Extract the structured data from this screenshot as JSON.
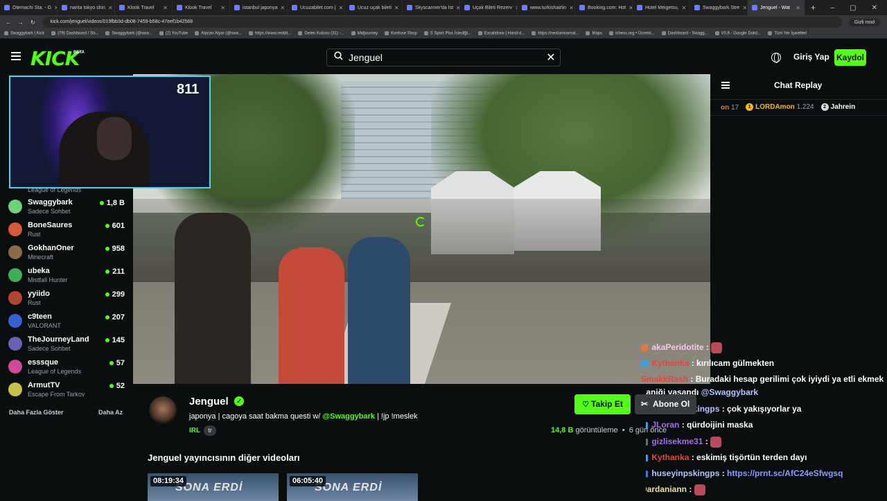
{
  "browser": {
    "tabs": [
      {
        "label": "Otemachi Sta. - G",
        "active": false
      },
      {
        "label": "narita tokyo shin",
        "active": false
      },
      {
        "label": "Klook Travel",
        "active": false
      },
      {
        "label": "Klook Travel",
        "active": false
      },
      {
        "label": "istanbul japonya",
        "active": false
      },
      {
        "label": "Ucuzabilet.com |",
        "active": false
      },
      {
        "label": "Ucuz uçak bileti",
        "active": false
      },
      {
        "label": "Skyscanner'da İst",
        "active": false
      },
      {
        "label": "Uçak Bileti Rezerv",
        "active": false
      },
      {
        "label": "www.turkishairlin",
        "active": false
      },
      {
        "label": "Booking.com: Hot",
        "active": false
      },
      {
        "label": "Hotel Meigetsu,",
        "active": false
      },
      {
        "label": "Swaggybark Stre",
        "active": false
      },
      {
        "label": "Jenguel - Wat",
        "active": true
      }
    ],
    "url": "kick.com/jenguel/videos/019fbb3d-db08-7459-b58c-47eef1b42568",
    "incognito_label": "Gizli mod",
    "bookmarks": [
      "Swaggybark | Kick",
      "(79) Dashboard / Str...",
      "Swaggybark (@swa...",
      "(2) YouTube",
      "Alpcan Alyar (@swa...",
      "https://www.reddit...",
      "Gelen Kutusu (31) -...",
      "Midjourney",
      "Konfuse Shop",
      "S Sport Plus İstediği...",
      "Excalidraw | Hand-d...",
      "https://nextunivarnat...",
      "Maps",
      "ichess.org • Ücretsi...",
      "Dashboard - Swagg...",
      "V0.8 - Google Dokü...",
      "Tüm Yer İşaretleri"
    ]
  },
  "header": {
    "logo": "KICK",
    "logo_badge": "BETA",
    "search_value": "Jenguel",
    "login_label": "Giriş Yap",
    "register_label": "Kaydol"
  },
  "overlay": {
    "viewer_count": "811",
    "partial_category": "League of Legends"
  },
  "sidebar": {
    "channels": [
      {
        "name": "Swaggybark",
        "category": "Sadece Sohbet",
        "viewers": "1,8 B",
        "color": "#6fd17a"
      },
      {
        "name": "BoneSaures",
        "category": "Rust",
        "viewers": "601",
        "color": "#d35a3a"
      },
      {
        "name": "GokhanOner",
        "category": "Minecraft",
        "viewers": "958",
        "color": "#8a6a4a"
      },
      {
        "name": "ubeka",
        "category": "Mistfall Hunter",
        "viewers": "211",
        "color": "#3fae5a"
      },
      {
        "name": "yyiido",
        "category": "Rust",
        "viewers": "299",
        "color": "#b2452f"
      },
      {
        "name": "c9teen",
        "category": "VALORANT",
        "viewers": "207",
        "color": "#3a5fd0"
      },
      {
        "name": "TheJourneyLand",
        "category": "Sadece Sohbet",
        "viewers": "145",
        "color": "#6b5fb0"
      },
      {
        "name": "esssque",
        "category": "League of Legends",
        "viewers": "57",
        "color": "#d04a9a"
      },
      {
        "name": "ArmutTV",
        "category": "Escape From Tarkov",
        "viewers": "52",
        "color": "#c9c24a"
      }
    ],
    "show_more": "Daha Fazla Göster",
    "show_less": "Daha Az"
  },
  "chat": {
    "title": "Chat Replay",
    "leaderboard": [
      {
        "name": "on",
        "count": "17",
        "rank": "",
        "rank_color": ""
      },
      {
        "name": "LORDAmon",
        "count": "1.224",
        "rank": "1",
        "rank_color": "#f5b921"
      },
      {
        "name": "Jahrein",
        "count": "",
        "rank": "2",
        "rank_color": "#d8d8d8"
      }
    ],
    "messages": [
      {
        "user": "akaPeridotite",
        "color": "#f8c9e8",
        "text": "",
        "emote": true,
        "badge": "#e07a3a"
      },
      {
        "user": "Kythanka",
        "color": "#e8443a",
        "text": "kırılıcam gülmekten",
        "emote": false,
        "badge": "#3aa0e0"
      },
      {
        "user": "SmakkRash",
        "color": "#e8443a",
        "text": "Buradaki hesap gerilimi çok iyiydi ya etli ekmek",
        "emote": false,
        "badge": ""
      },
      {
        "user": "",
        "color": "#ffffff",
        "text": "paniği yaşandı",
        "mention": "@Swaggybark",
        "emote": false,
        "badge": ""
      },
      {
        "user": "huseyinpskingps",
        "color": "#b8c4ff",
        "text": "çok yakışıyorlar ya",
        "emote": false,
        "badge": "#3a7ae0"
      },
      {
        "user": "JLoran",
        "color": "#a86af0",
        "text": "qürdoijini maska",
        "emote": false,
        "badge": "#3aa0e0"
      },
      {
        "user": "gizlisekme31",
        "color": "#a86af0",
        "text": "",
        "emote": true,
        "badge": "#6a6a6a"
      },
      {
        "user": "Kythanka",
        "color": "#e8443a",
        "text": "eskimiş tişörtün terden dayı",
        "emote": false,
        "badge": "#3aa0e0"
      },
      {
        "user": "huseyinpskingps",
        "color": "#b8c4ff",
        "text": "",
        "link": "https://prnt.sc/AfC24eSfwgsq",
        "emote": false,
        "badge": "#3a7ae0"
      },
      {
        "user": "Dardaniann",
        "color": "#f0dca0",
        "text": "",
        "emote": true,
        "badge": ""
      }
    ]
  },
  "streamer": {
    "name": "Jenguel",
    "title_prefix": "japonya | cagoya saat bakma questi w/ ",
    "title_mention": "@Swaggybark",
    "title_suffix": " | !jp !meslek",
    "category": "IRL",
    "tag": "tr",
    "follow_label": "Takip Et",
    "subscribe_label": "Abone Ol",
    "views_count": "14,8 B",
    "views_label": "görüntüleme",
    "time_ago": "6 gün önce",
    "other_videos_heading": "Jenguel yayıncısının diğer videoları",
    "videos": [
      {
        "duration": "08:19:34",
        "title_text": "SONA ERDİ"
      },
      {
        "duration": "06:05:40",
        "title_text": "SONA ERDİ"
      }
    ]
  },
  "colors": {
    "accent": "#53fc18",
    "background": "#0b0e0f"
  }
}
